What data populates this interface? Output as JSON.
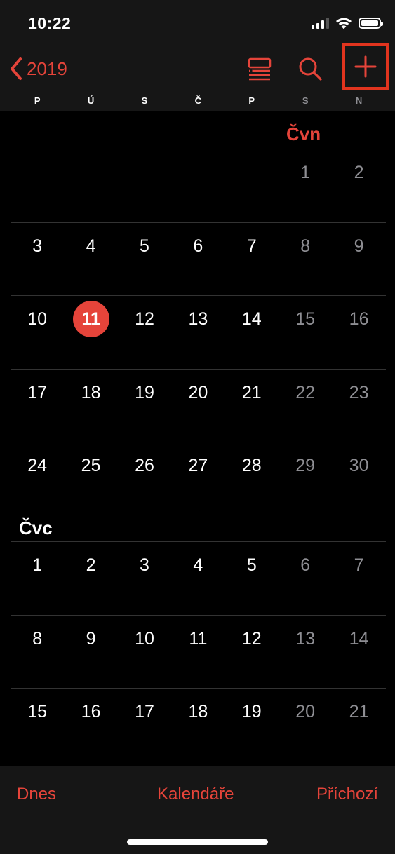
{
  "status_bar": {
    "time": "10:22",
    "icons": [
      "cellular-signal-icon",
      "wifi-icon",
      "battery-icon"
    ]
  },
  "nav": {
    "back_label": "2019",
    "icons": [
      "chevron-left-icon",
      "list-view-icon",
      "search-icon",
      "plus-icon"
    ]
  },
  "weekdays": [
    "P",
    "Ú",
    "S",
    "Č",
    "P",
    "S",
    "N"
  ],
  "months": [
    {
      "title": "Čvn",
      "weeks": [
        [
          "",
          "",
          "",
          "",
          "",
          "1",
          "2"
        ],
        [
          "3",
          "4",
          "5",
          "6",
          "7",
          "8",
          "9"
        ],
        [
          "10",
          "11",
          "12",
          "13",
          "14",
          "15",
          "16"
        ],
        [
          "17",
          "18",
          "19",
          "20",
          "21",
          "22",
          "23"
        ],
        [
          "24",
          "25",
          "26",
          "27",
          "28",
          "29",
          "30"
        ]
      ]
    },
    {
      "title": "Čvc",
      "weeks": [
        [
          "1",
          "2",
          "3",
          "4",
          "5",
          "6",
          "7"
        ],
        [
          "8",
          "9",
          "10",
          "11",
          "12",
          "13",
          "14"
        ],
        [
          "15",
          "16",
          "17",
          "18",
          "19",
          "20",
          "21"
        ]
      ]
    }
  ],
  "today": "11",
  "colors": {
    "accent": "#e5443a",
    "highlight_box": "#e1341e",
    "weekend_text": "#8e8e93",
    "bar_background": "#161616"
  },
  "toolbar": {
    "today_label": "Dnes",
    "calendars_label": "Kalendáře",
    "inbox_label": "Příchozí"
  }
}
